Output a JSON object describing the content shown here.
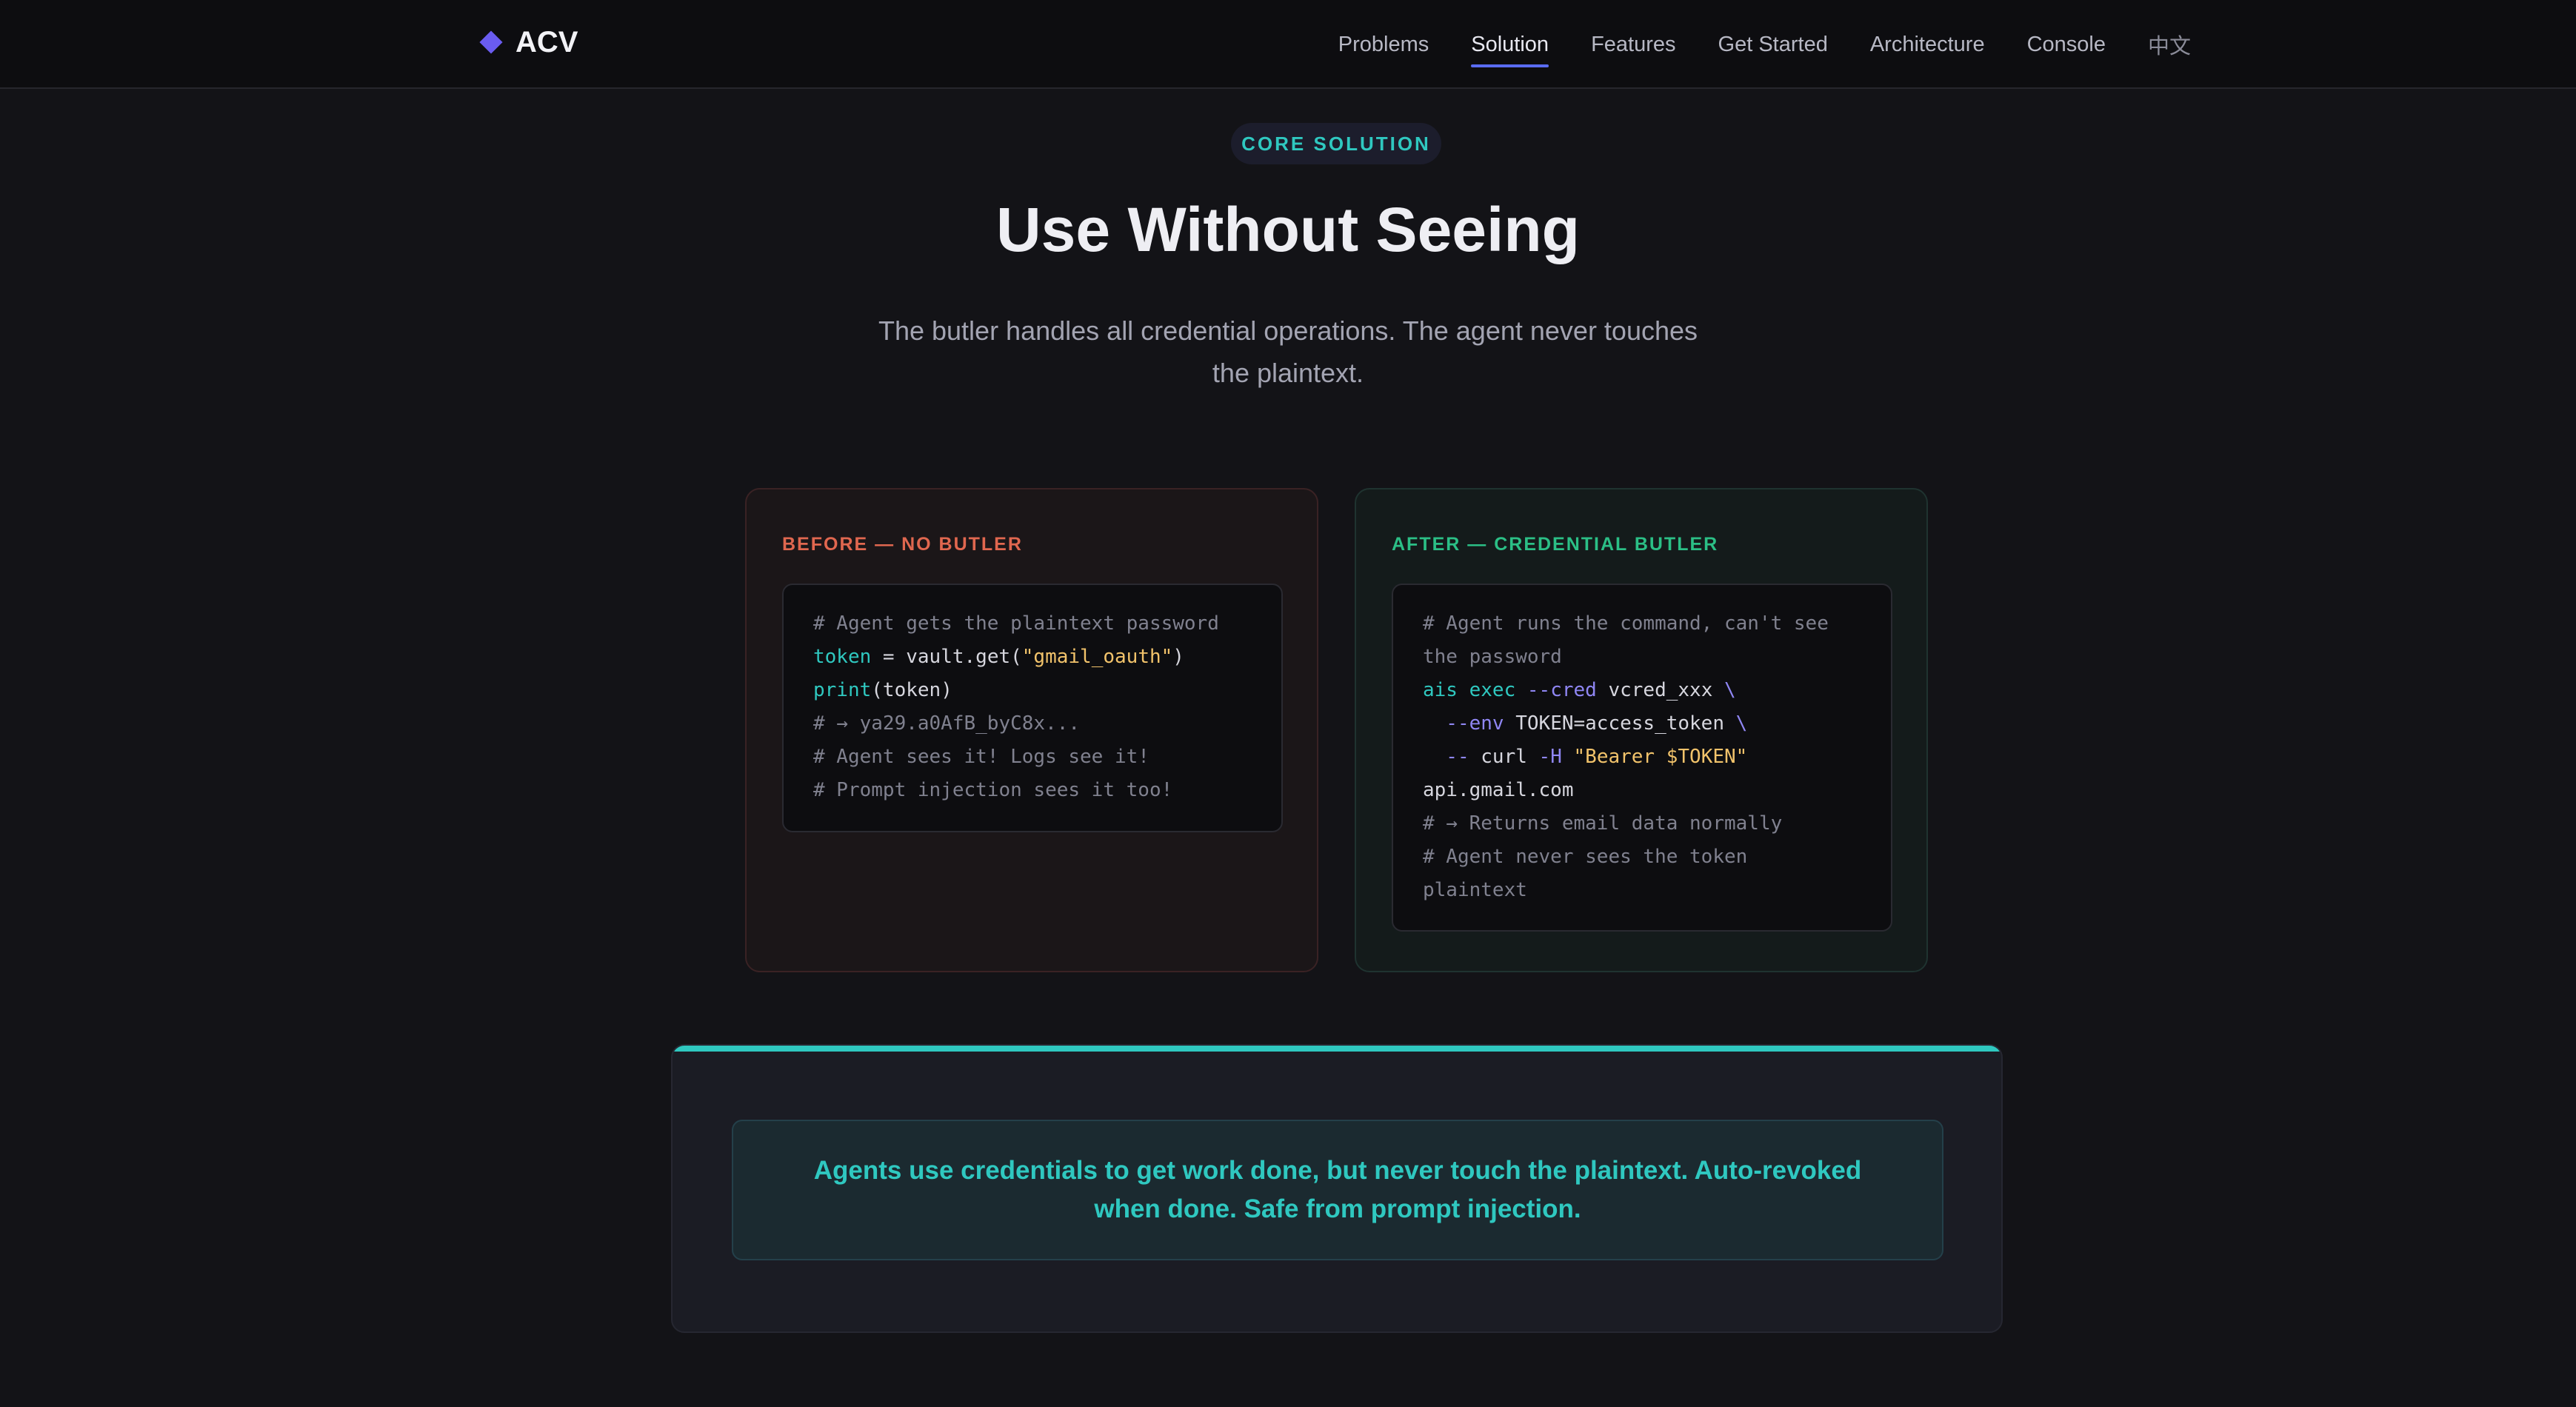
{
  "nav": {
    "brand": "ACV",
    "links": [
      {
        "label": "Problems"
      },
      {
        "label": "Solution",
        "active": true
      },
      {
        "label": "Features"
      },
      {
        "label": "Get Started"
      },
      {
        "label": "Architecture"
      },
      {
        "label": "Console"
      },
      {
        "label": "中文"
      }
    ]
  },
  "hero": {
    "badge": "CORE SOLUTION",
    "title": "Use Without Seeing",
    "subtitle": "The butler handles all credential operations. The agent never touches the plaintext."
  },
  "before": {
    "label": "BEFORE — NO BUTLER",
    "code": {
      "line1": "# Agent gets the plaintext password",
      "token": "token",
      "eq": " = vault.get(",
      "arg": "\"gmail_oauth\"",
      "close": ")",
      "print": "print",
      "printarg": "(token)",
      "line4": "# → ya29.a0AfB_byC8x...",
      "line5": "# Agent sees it! Logs see it!",
      "line6": "# Prompt injection sees it too!"
    }
  },
  "after": {
    "label": "AFTER — CREDENTIAL BUTLER",
    "code": {
      "line1a": "# Agent runs the command, can't see",
      "line1b": "the password",
      "cmd": "ais exec",
      "flag_cred": "--cred",
      "cred_val": " vcred_xxx ",
      "bs1": "\\",
      "flag_env": "  --env",
      "env_val": " TOKEN=access_token ",
      "bs2": "\\",
      "dashdash": "  --",
      "curl": " curl ",
      "flag_h": "-H",
      "header": " \"Bearer $TOKEN\"",
      "host": "api.gmail.com",
      "note1": "# → Returns email data normally",
      "note2a": "# Agent never sees the token",
      "note2b": "plaintext"
    }
  },
  "banner": {
    "text": "Agents use credentials to get work done, but never touch the plaintext. Auto-revoked when done. Safe from prompt injection."
  },
  "colors": {
    "accent_teal": "#2fc8c0",
    "accent_purple": "#6a5cf0",
    "before_red": "#e0674f",
    "after_green": "#2bbf86",
    "string_gold": "#f2c36b"
  }
}
